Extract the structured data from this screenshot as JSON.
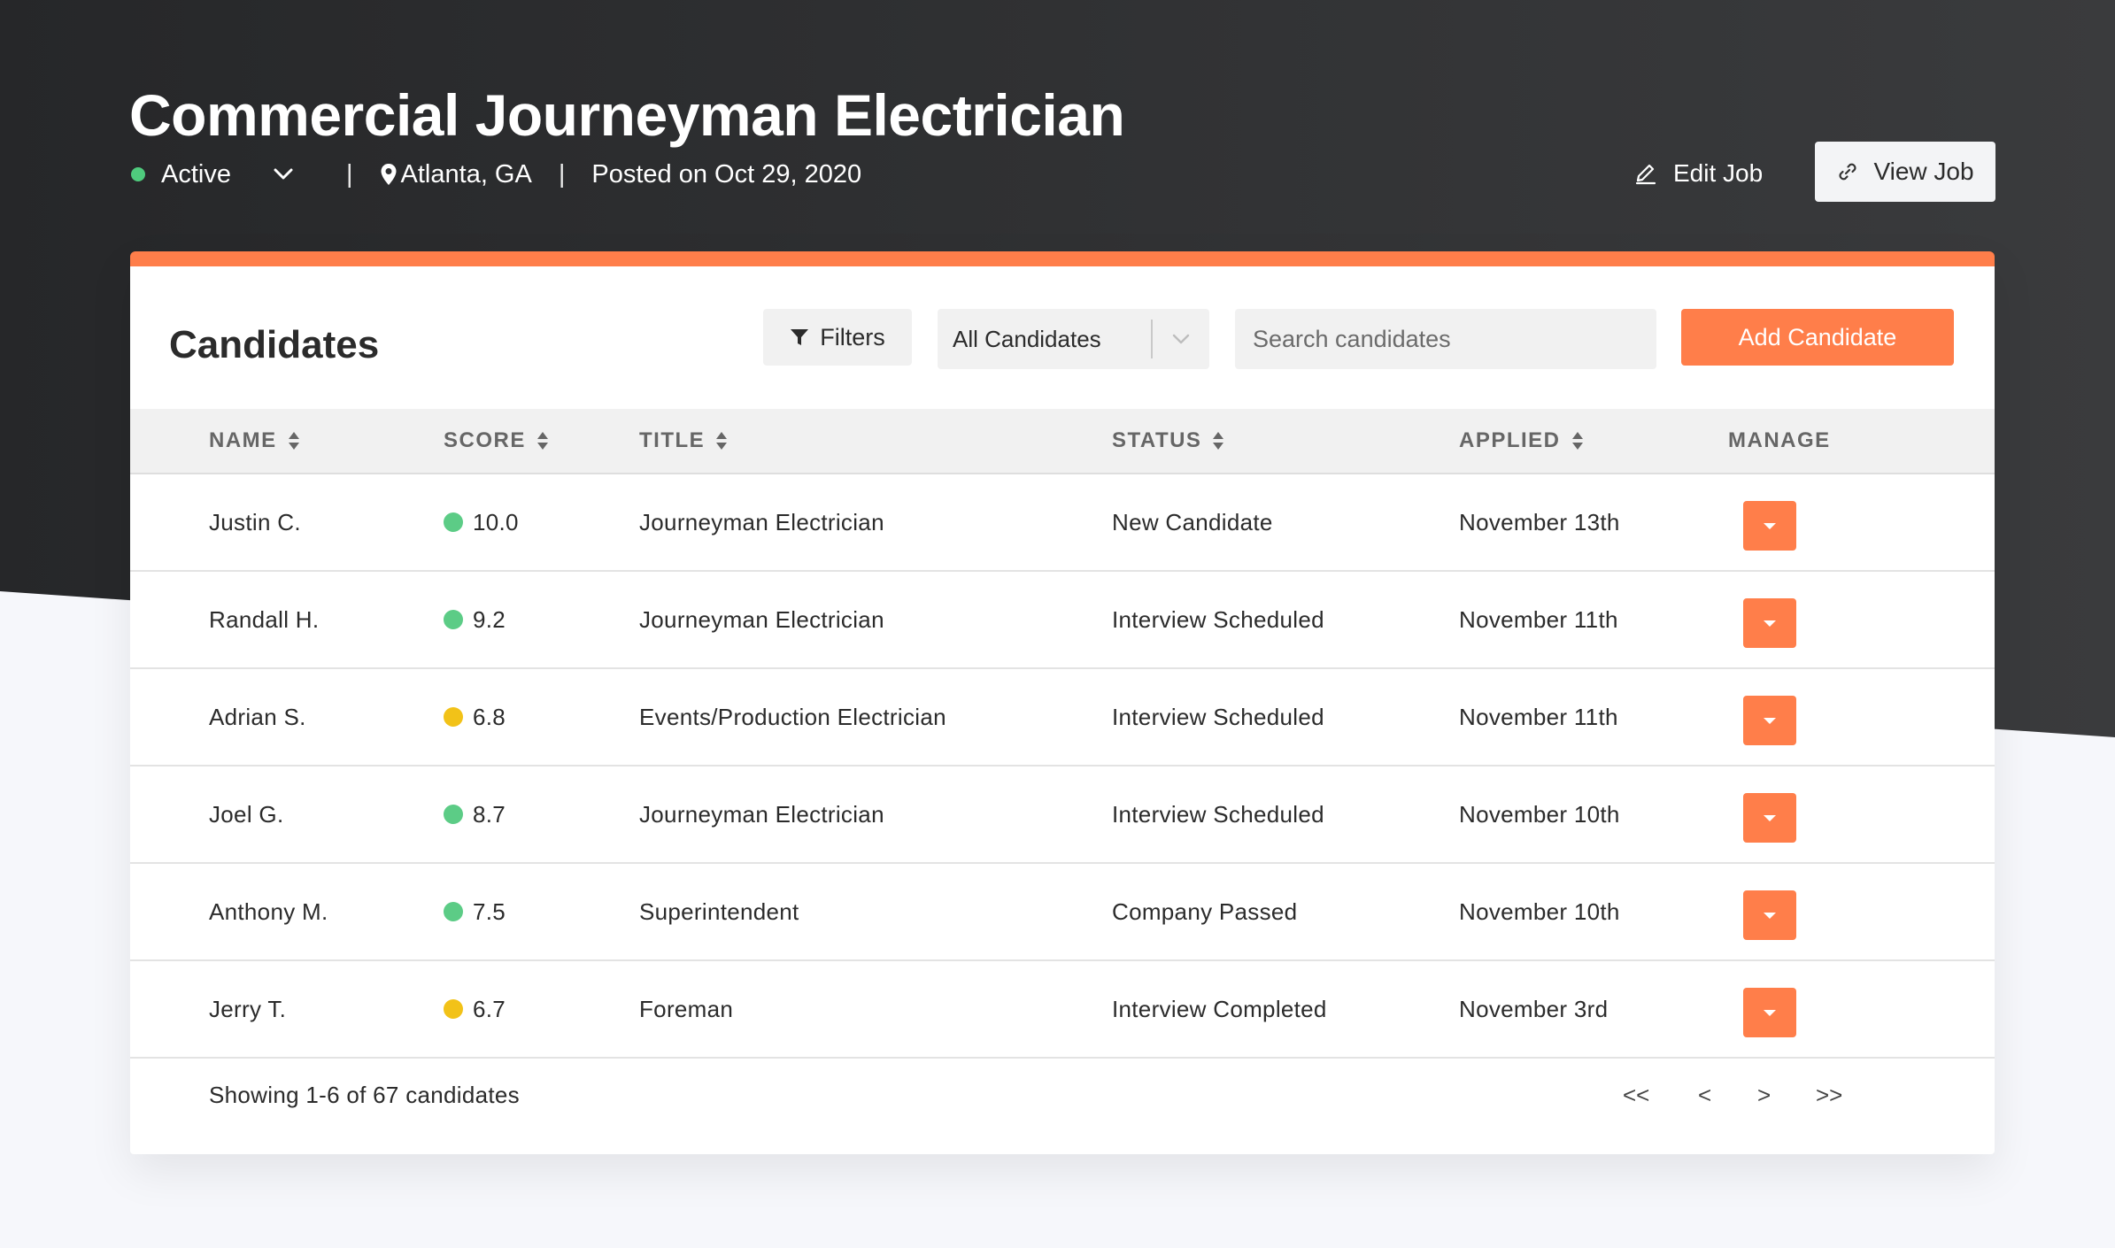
{
  "header": {
    "title": "Commercial Journeyman Electrician",
    "status": "Active",
    "separator": "|",
    "location": "Atlanta, GA",
    "posted": "Posted on Oct 29, 2020",
    "edit_job_label": "Edit Job",
    "view_job_label": "View Job"
  },
  "candidates": {
    "title": "Candidates",
    "filters_label": "Filters",
    "select_value": "All Candidates",
    "search_placeholder": "Search candidates",
    "add_label": "Add Candidate",
    "columns": {
      "name": "NAME",
      "score": "SCORE",
      "title": "TITLE",
      "status": "STATUS",
      "applied": "APPLIED",
      "manage": "MANAGE"
    },
    "rows": [
      {
        "name": "Justin C.",
        "score": "10.0",
        "score_color": "#5ccc86",
        "title": "Journeyman Electrician",
        "status": "New Candidate",
        "applied": "November 13th"
      },
      {
        "name": "Randall H.",
        "score": "9.2",
        "score_color": "#5ccc86",
        "title": "Journeyman Electrician",
        "status": "Interview Scheduled",
        "applied": "November 11th"
      },
      {
        "name": "Adrian S.",
        "score": "6.8",
        "score_color": "#f2c218",
        "title": "Events/Production Electrician",
        "status": "Interview Scheduled",
        "applied": "November 11th"
      },
      {
        "name": "Joel G.",
        "score": "8.7",
        "score_color": "#5ccc86",
        "title": "Journeyman Electrician",
        "status": "Interview Scheduled",
        "applied": "November 10th"
      },
      {
        "name": "Anthony M.",
        "score": "7.5",
        "score_color": "#5ccc86",
        "title": "Superintendent",
        "status": "Company Passed",
        "applied": "November 10th"
      },
      {
        "name": "Jerry T.",
        "score": "6.7",
        "score_color": "#f2c218",
        "title": "Foreman",
        "status": "Interview Completed",
        "applied": "November 3rd"
      }
    ],
    "footer": {
      "showing": "Showing 1-6 of 67 candidates",
      "first": "<<",
      "prev": "<",
      "next": ">",
      "last": ">>"
    }
  },
  "colors": {
    "accent": "#ff7e4a",
    "active_status": "#4fcb7d"
  },
  "icons": {
    "status": "dot-icon",
    "dropdown": "chevron-down-icon",
    "location": "map-pin-icon",
    "edit": "pencil-icon",
    "view": "link-icon",
    "filter": "funnel-icon",
    "sort": "sort-icon",
    "manage": "caret-down-icon"
  }
}
